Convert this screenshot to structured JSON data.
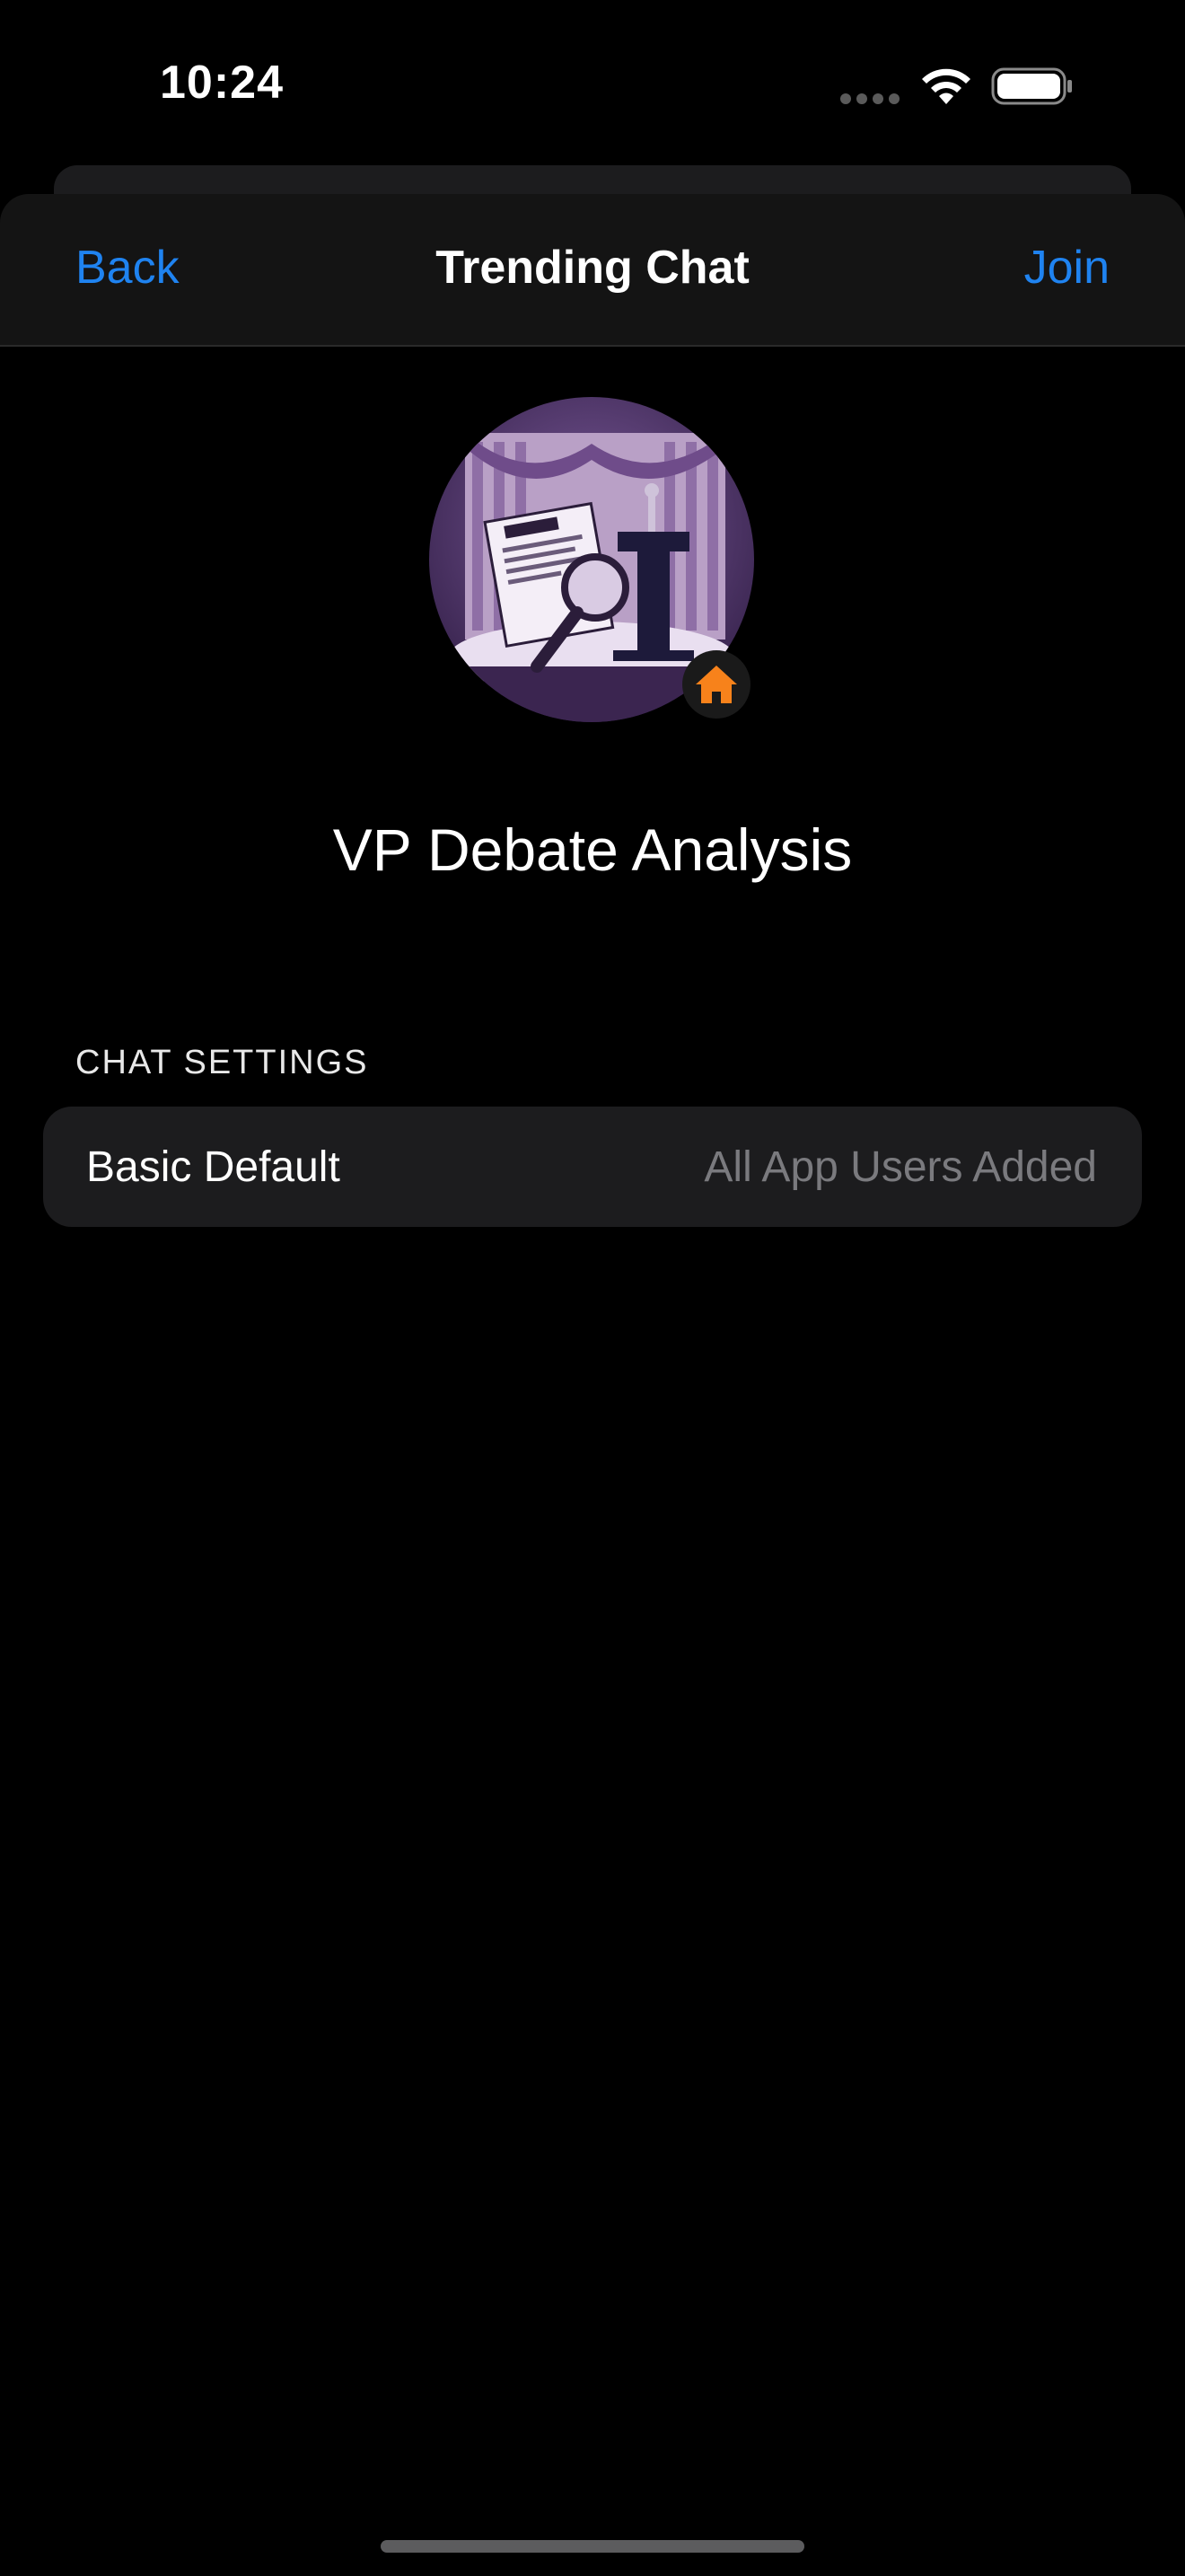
{
  "status_bar": {
    "time": "10:24",
    "signal_icon": "cellular-dots-icon",
    "wifi_icon": "wifi-icon",
    "battery_icon": "battery-full-icon"
  },
  "nav": {
    "back_label": "Back",
    "title": "Trending Chat",
    "join_label": "Join",
    "accent_color": "#1f83f0"
  },
  "chat": {
    "avatar_icon": "debate-analysis-avatar",
    "badge_icon": "home-icon",
    "badge_color": "#f7821b",
    "name": "VP Debate Analysis"
  },
  "settings": {
    "header": "CHAT SETTINGS",
    "rows": [
      {
        "label": "Basic Default",
        "value": "All App Users Added"
      }
    ]
  }
}
